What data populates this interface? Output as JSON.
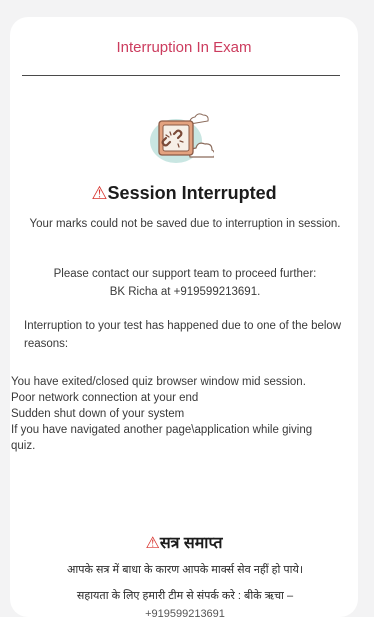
{
  "card": {
    "title": "Interruption In Exam"
  },
  "illustration": {
    "name": "broken-link-icon"
  },
  "english": {
    "warning_symbol": "⚠",
    "heading": "Session Interrupted",
    "message": "Your marks could not be saved due to interruption in session.",
    "contact_line": "Please contact our support team to proceed further:",
    "contact_person": "BK Richa at +919599213691.",
    "reasons_intro": "Interruption to your test has happened due to one of the below reasons:",
    "reasons": [
      "You have exited/closed quiz browser window mid session.",
      "Poor network connection at your end",
      "Sudden shut down of your system",
      "If you have navigated another page\\application while giving quiz."
    ]
  },
  "hindi": {
    "warning_symbol": "⚠",
    "heading": "सत्र समाप्त",
    "message": "आपके सत्र में बाधा के कारण आपके मार्क्स सेव नहीं हो पाये।",
    "contact_line": "सहायता के लिए हमारी टीम से संपर्क करे : बीके ऋचा –",
    "contact_number": "+919599213691"
  },
  "colors": {
    "accent": "#cc3c5e",
    "warning": "#d8342e",
    "illustration_bg": "#c9e6e2",
    "illustration_frame": "#e3a27f"
  }
}
